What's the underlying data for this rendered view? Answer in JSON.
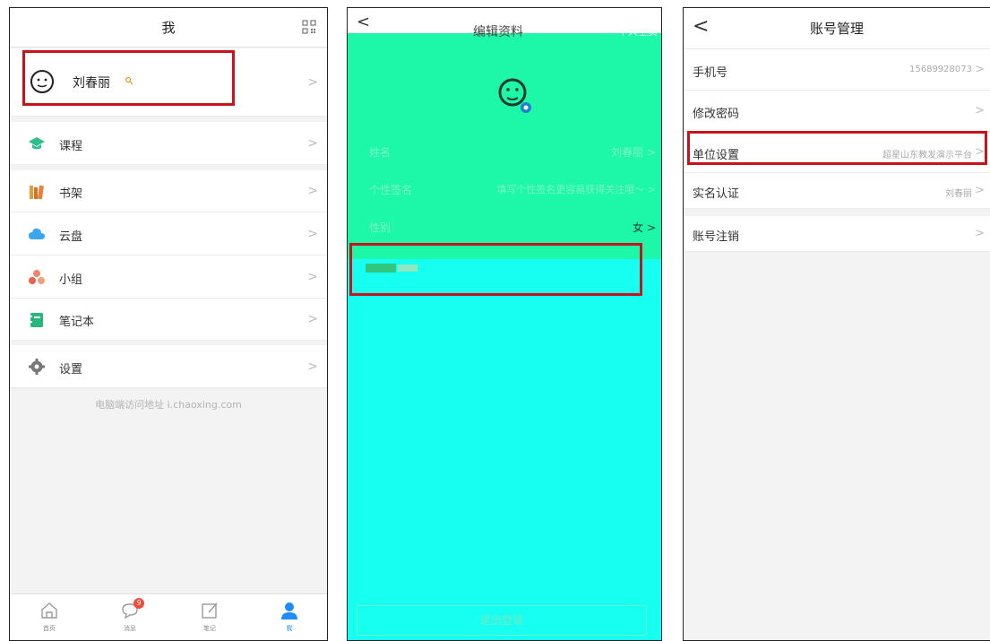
{
  "panel1": {
    "title": "我",
    "profile": {
      "name": "刘春丽"
    },
    "menu": [
      {
        "label": "课程",
        "icon": "graduation-cap-icon"
      },
      {
        "label": "书架",
        "icon": "bookshelf-icon"
      },
      {
        "label": "云盘",
        "icon": "cloud-icon"
      },
      {
        "label": "小组",
        "icon": "group-icon"
      },
      {
        "label": "笔记本",
        "icon": "notebook-icon"
      },
      {
        "label": "设置",
        "icon": "gear-icon"
      }
    ],
    "hint": "电脑端访问地址 i.chaoxing.com",
    "tabs": [
      {
        "label": "首页"
      },
      {
        "label": "消息",
        "badge": "9"
      },
      {
        "label": "笔记"
      },
      {
        "label": "我"
      }
    ],
    "chevron": ">"
  },
  "panel2": {
    "back": "<",
    "title": "编辑资料",
    "header_right": "个人主页",
    "rows": [
      {
        "label": "姓名",
        "value": "刘春丽 >"
      },
      {
        "label": "个性签名",
        "value": "填写个性签名更容易获得关注哦～ >"
      },
      {
        "label": "性别",
        "value": "女 >"
      }
    ],
    "logout": "退出登录"
  },
  "panel3": {
    "back": "<",
    "title": "账号管理",
    "rows": [
      {
        "label": "手机号",
        "value": "15689928073"
      },
      {
        "label": "修改密码",
        "value": ""
      },
      {
        "label": "单位设置",
        "value": "超星山东教发演示平台"
      },
      {
        "label": "实名认证",
        "value": "刘春丽"
      },
      {
        "label": "账号注销",
        "value": ""
      }
    ],
    "chevron": ">"
  },
  "colors": {
    "accent": "#1e8bff",
    "highlight": "#c8131d",
    "green": "#1cf8a8",
    "cyan": "#16fff0"
  }
}
